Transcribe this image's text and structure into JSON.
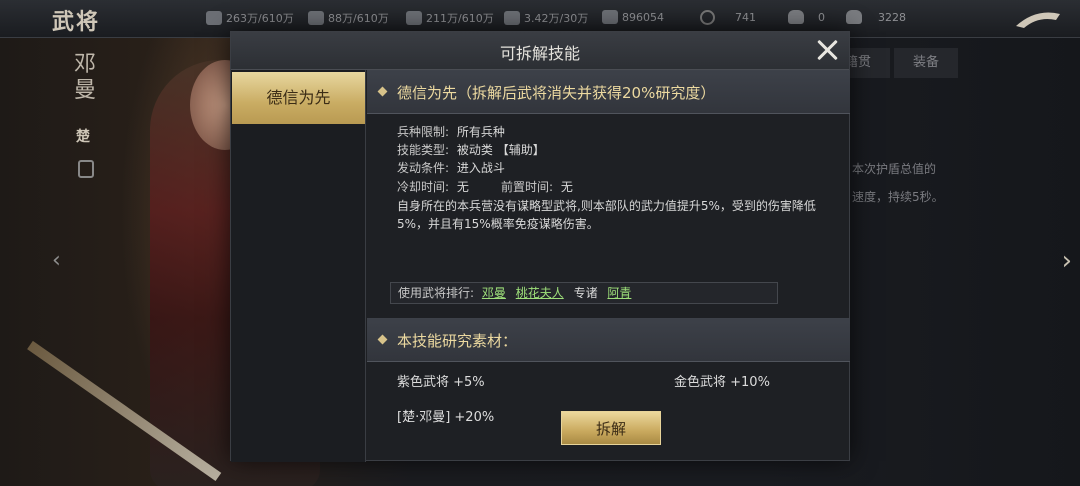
{
  "topbar": {
    "title": "武将",
    "resources": [
      {
        "icon": "wood-icon",
        "value": "263万/610万"
      },
      {
        "icon": "stone-icon",
        "value": "88万/610万"
      },
      {
        "icon": "iron-icon",
        "value": "211万/610万"
      },
      {
        "icon": "grain-icon",
        "value": "3.42万/30万"
      },
      {
        "icon": "token-icon",
        "value": "896054"
      },
      {
        "icon": "coin-icon",
        "value": "741"
      },
      {
        "icon": "gold-ingot-icon",
        "value": "0"
      },
      {
        "icon": "silver-ingot-icon",
        "value": "3228"
      }
    ]
  },
  "background": {
    "general_name": "邓曼",
    "faction": "楚",
    "tabs": [
      "籍贯",
      "装备"
    ],
    "side_text_1": "本次护盾总值的",
    "side_text_2": "速度，持续5秒。"
  },
  "modal": {
    "title": "可拆解技能",
    "skills": [
      {
        "label": "德信为先"
      }
    ],
    "detail": {
      "header": "德信为先（拆解后武将消失并获得20%研究度）",
      "troop_limit_key": "兵种限制:",
      "troop_limit_val": "所有兵种",
      "skill_type_key": "技能类型:",
      "skill_type_val": "被动类 【辅助】",
      "trigger_key": "发动条件:",
      "trigger_val": "进入战斗",
      "cooldown_key": "冷却时间:",
      "cooldown_val": "无",
      "precast_key": "前置时间:",
      "precast_val": "无",
      "description": "自身所在的本兵营没有谋略型武将,则本部队的武力值提升5%，受到的伤害降低5%，并且有15%概率免疫谋略伤害。",
      "users_label": "使用武将排行:",
      "users": [
        {
          "name": "邓曼",
          "highlight": true
        },
        {
          "name": "桃花夫人",
          "highlight": true
        },
        {
          "name": "专诸",
          "highlight": false
        },
        {
          "name": "阿青",
          "highlight": true
        }
      ]
    },
    "materials": {
      "header": "本技能研究素材：",
      "purple": "紫色武将 +5%",
      "gold": "金色武将 +10%",
      "specific": "[楚·邓曼] +20%"
    },
    "dismantle_label": "拆解"
  },
  "colors": {
    "gold_accent": "#c9ac63",
    "highlight_green": "#9ee07a",
    "header_text": "#ecd9a0"
  }
}
